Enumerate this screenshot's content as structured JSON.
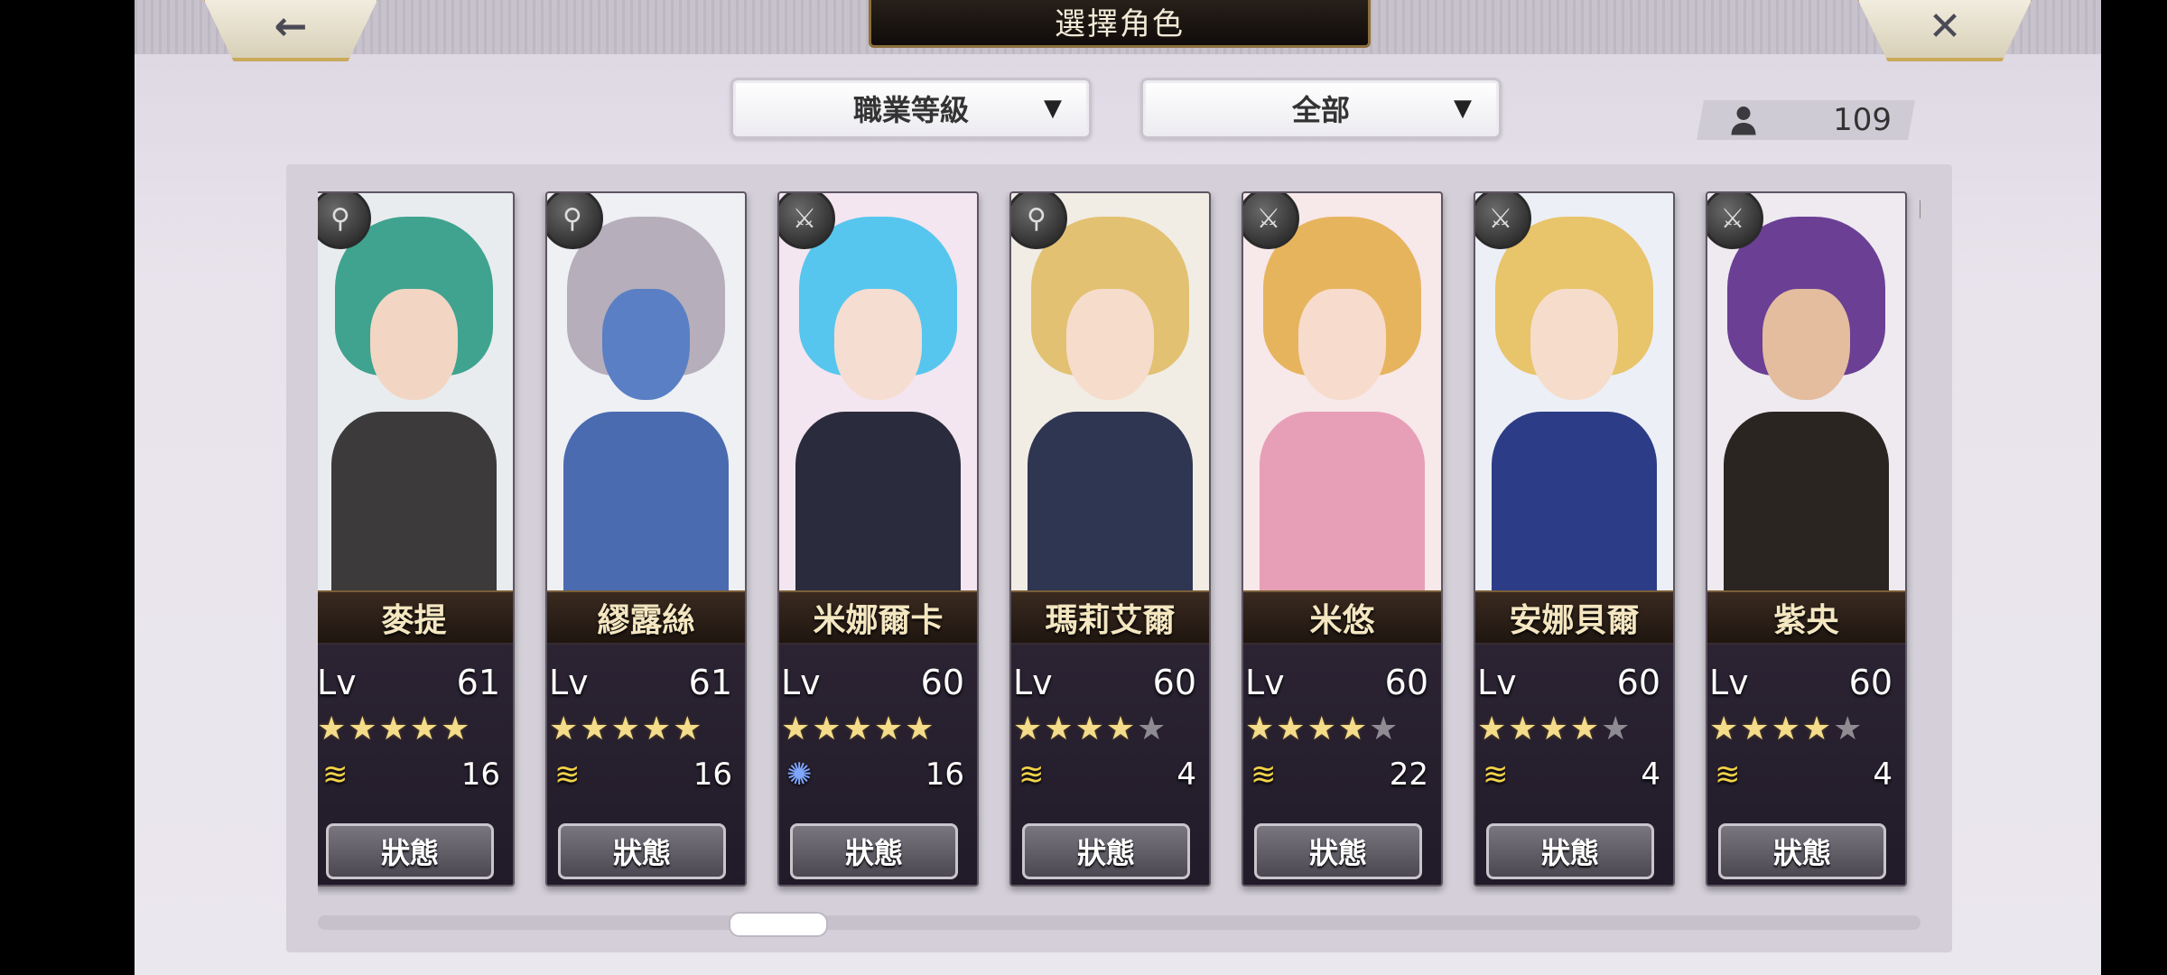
{
  "header": {
    "title": "選擇角色",
    "back_icon": "←",
    "close_icon": "✕"
  },
  "filters": {
    "class_sort": {
      "label": "職業等級",
      "caret": "▼"
    },
    "type_filter": {
      "label": "全部",
      "caret": "▼"
    }
  },
  "roster_count": "109",
  "level_prefix": "Lv",
  "status_label": "狀態",
  "characters": [
    {
      "name": "麥提",
      "level": "61",
      "stars": 5,
      "max_stars": 5,
      "element": "wind",
      "element_glyph": "≋",
      "count": "16",
      "class_glyph": "⚲",
      "colors": {
        "bg": "#e9ecef",
        "hair": "#3fa38f",
        "skin": "#f2d6c3",
        "body": "#3c3a3a"
      }
    },
    {
      "name": "繆露絲",
      "level": "61",
      "stars": 5,
      "max_stars": 5,
      "element": "wind",
      "element_glyph": "≋",
      "count": "16",
      "class_glyph": "⚲",
      "colors": {
        "bg": "#eef0f4",
        "hair": "#b6aebb",
        "skin": "#5a7fc4",
        "body": "#4a6bb0"
      }
    },
    {
      "name": "米娜爾卡",
      "level": "60",
      "stars": 5,
      "max_stars": 5,
      "element": "swirl",
      "element_glyph": "✺",
      "count": "16",
      "class_glyph": "⚔",
      "colors": {
        "bg": "#f3e6f0",
        "hair": "#57c6ee",
        "skin": "#f5ddd1",
        "body": "#2a2b3c"
      }
    },
    {
      "name": "瑪莉艾爾",
      "level": "60",
      "stars": 4,
      "max_stars": 5,
      "element": "wind",
      "element_glyph": "≋",
      "count": "4",
      "class_glyph": "⚲",
      "colors": {
        "bg": "#f1ede5",
        "hair": "#e2c172",
        "skin": "#f6dccb",
        "body": "#2f3652"
      }
    },
    {
      "name": "米悠",
      "level": "60",
      "stars": 4,
      "max_stars": 5,
      "element": "wind",
      "element_glyph": "≋",
      "count": "22",
      "class_glyph": "⚔",
      "colors": {
        "bg": "#f7e8ea",
        "hair": "#e7b45e",
        "skin": "#f7dccd",
        "body": "#e79fb7"
      }
    },
    {
      "name": "安娜貝爾",
      "level": "60",
      "stars": 4,
      "max_stars": 5,
      "element": "wind",
      "element_glyph": "≋",
      "count": "4",
      "class_glyph": "⚔",
      "colors": {
        "bg": "#eceff5",
        "hair": "#e8c46b",
        "skin": "#f6dccb",
        "body": "#2c3c86"
      }
    },
    {
      "name": "紫央",
      "level": "60",
      "stars": 4,
      "max_stars": 5,
      "element": "wind",
      "element_glyph": "≋",
      "count": "4",
      "class_glyph": "⚔",
      "colors": {
        "bg": "#eeeaf0",
        "hair": "#6a3f94",
        "skin": "#e3bd9e",
        "body": "#2b2522"
      }
    }
  ]
}
